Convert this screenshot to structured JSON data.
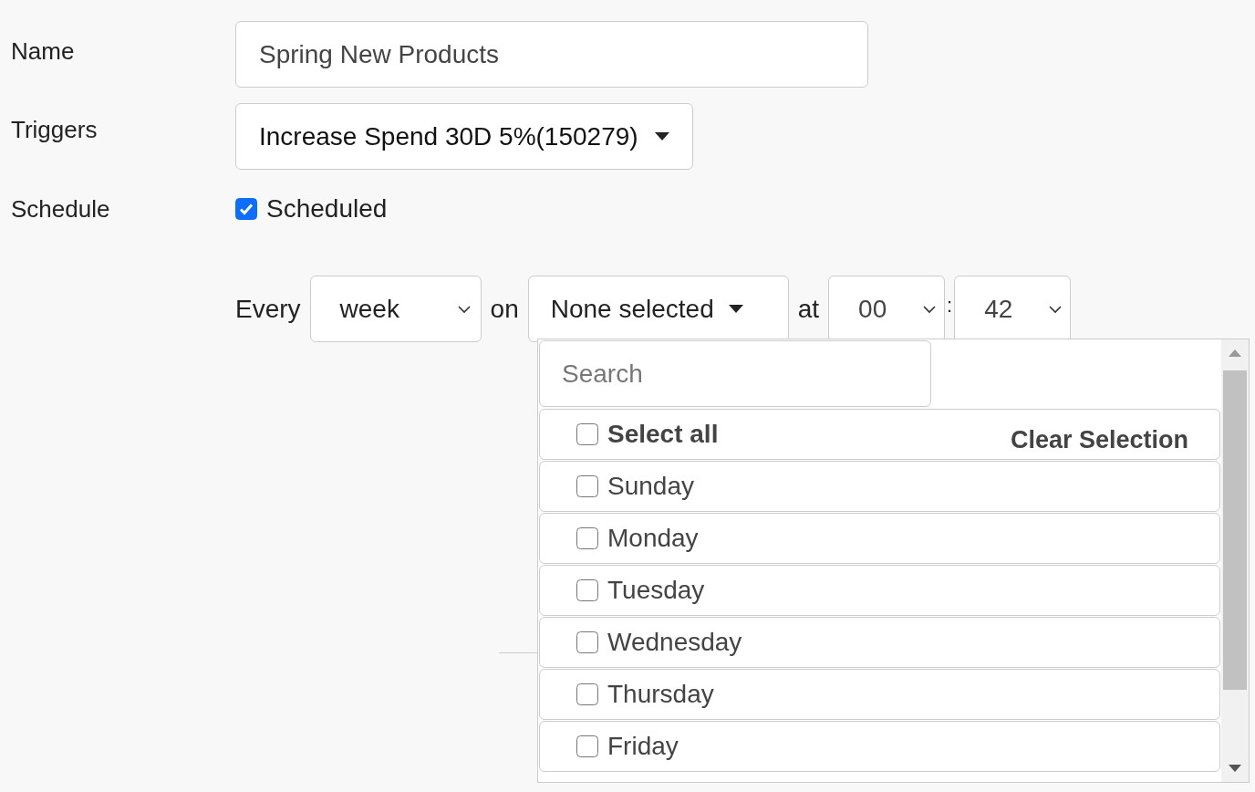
{
  "form": {
    "name": {
      "label": "Name",
      "value": "Spring New Products"
    },
    "triggers": {
      "label": "Triggers",
      "value": "Increase Spend 30D 5%(150279)"
    },
    "schedule": {
      "label": "Schedule",
      "checkbox": {
        "label": "Scheduled",
        "checked": true
      }
    }
  },
  "recurrence": {
    "every": "Every",
    "period": "week",
    "on": "on",
    "days": "None selected",
    "at": "at",
    "hour": "00",
    "separator": ":",
    "minute": "42"
  },
  "dropdown": {
    "search_placeholder": "Search",
    "select_all": {
      "label": "Select all",
      "checked": false
    },
    "clear": "Clear Selection",
    "options": [
      {
        "label": "Sunday",
        "checked": false
      },
      {
        "label": "Monday",
        "checked": false
      },
      {
        "label": "Tuesday",
        "checked": false
      },
      {
        "label": "Wednesday",
        "checked": false
      },
      {
        "label": "Thursday",
        "checked": false
      },
      {
        "label": "Friday",
        "checked": false
      }
    ]
  }
}
